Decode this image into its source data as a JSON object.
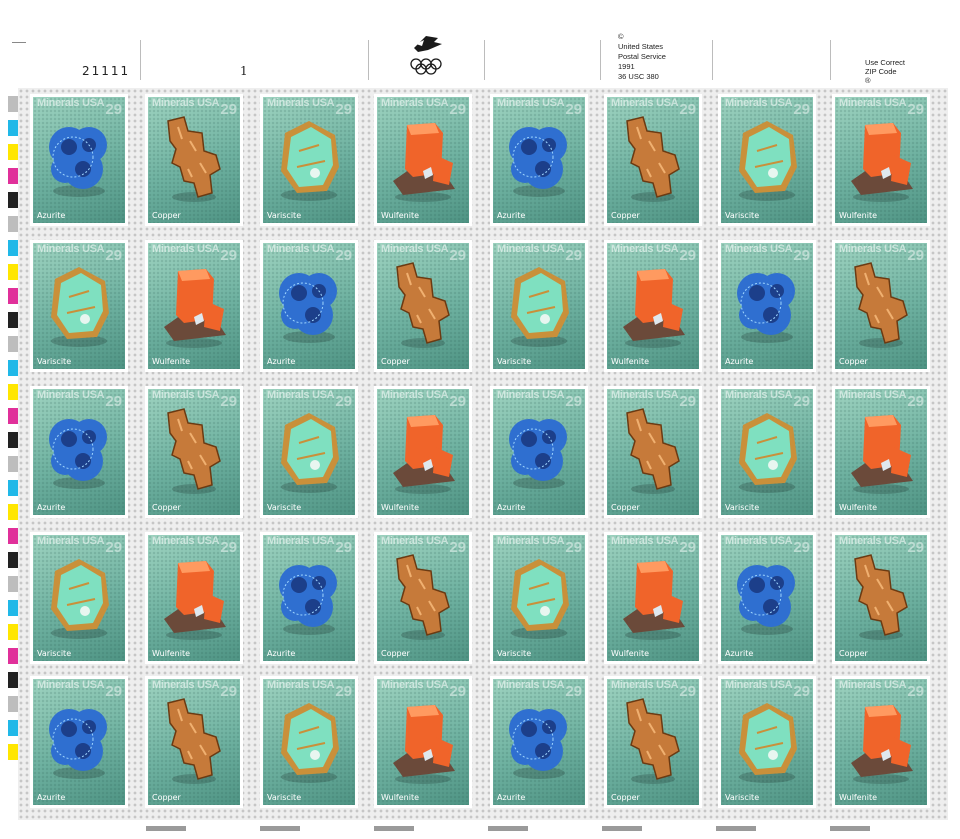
{
  "selvage": {
    "plate_number": "21111",
    "plate_mark": "1",
    "copyright_lines": [
      "©",
      "United States",
      "Postal Service",
      "1991",
      "36 USC 380"
    ],
    "zip_lines": [
      "Use Correct",
      "ZIP Code",
      "®"
    ]
  },
  "stamp_header": "Minerals USA",
  "stamp_denomination": "29",
  "minerals": {
    "azurite": {
      "name": "Azurite",
      "color": "#2f6fd0",
      "icon": "azurite-mineral-icon"
    },
    "copper": {
      "name": "Copper",
      "color": "#c67a3a",
      "icon": "copper-mineral-icon"
    },
    "variscite": {
      "name": "Variscite",
      "color": "#7fe0c0",
      "icon": "variscite-mineral-icon"
    },
    "wulfenite": {
      "name": "Wulfenite",
      "color": "#f0642a",
      "icon": "wulfenite-mineral-icon"
    }
  },
  "stamp_rows": [
    [
      "Azurite",
      "Copper",
      "Variscite",
      "Wulfenite",
      "Azurite",
      "Copper",
      "Variscite",
      "Wulfenite"
    ],
    [
      "Variscite",
      "Wulfenite",
      "Azurite",
      "Copper",
      "Variscite",
      "Wulfenite",
      "Azurite",
      "Copper"
    ],
    [
      "Azurite",
      "Copper",
      "Variscite",
      "Wulfenite",
      "Azurite",
      "Copper",
      "Variscite",
      "Wulfenite"
    ],
    [
      "Variscite",
      "Wulfenite",
      "Azurite",
      "Copper",
      "Variscite",
      "Wulfenite",
      "Azurite",
      "Copper"
    ],
    [
      "Azurite",
      "Copper",
      "Variscite",
      "Wulfenite",
      "Azurite",
      "Copper",
      "Variscite",
      "Wulfenite"
    ]
  ],
  "registration_colors": [
    "#bdbdbd",
    "#20b8e8",
    "#ffe600",
    "#e0309a",
    "#222222",
    "#bdbdbd",
    "#20b8e8",
    "#ffe600",
    "#e0309a",
    "#222222",
    "#bdbdbd",
    "#20b8e8",
    "#ffe600",
    "#e0309a",
    "#222222",
    "#bdbdbd",
    "#20b8e8",
    "#ffe600",
    "#e0309a",
    "#222222",
    "#bdbdbd",
    "#20b8e8",
    "#ffe600",
    "#e0309a",
    "#222222",
    "#bdbdbd",
    "#20b8e8",
    "#ffe600"
  ]
}
